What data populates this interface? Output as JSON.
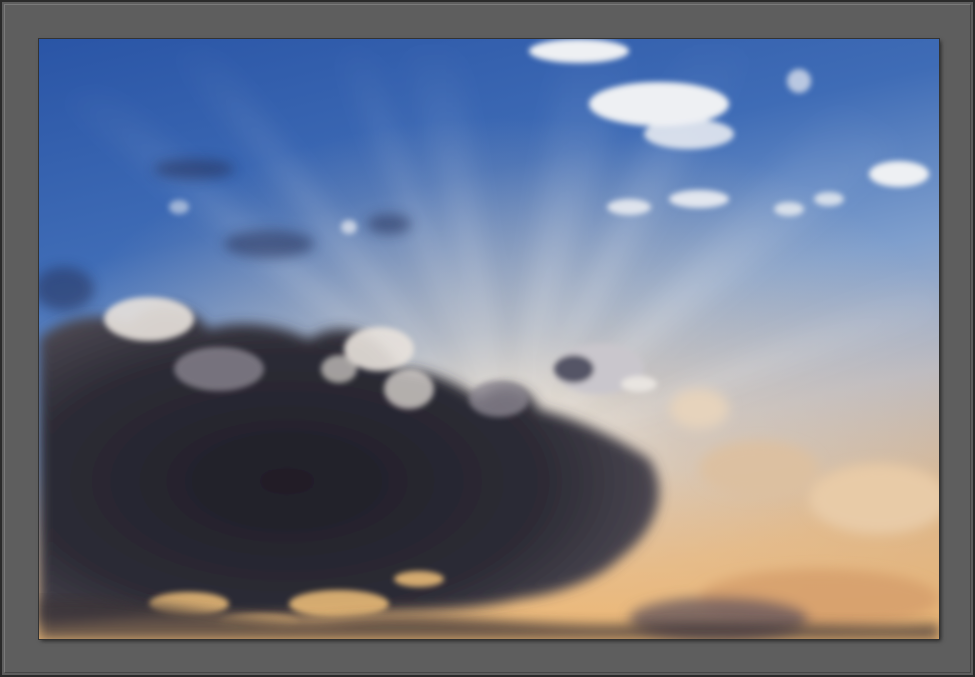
{
  "photo": {
    "subject": "sky-with-clouds-and-sun-rays",
    "colors": {
      "frame": "#5e5e5e",
      "sky_top": "#2f5aa8",
      "sky_mid": "#6e95cc",
      "horizon_glow": "#e8c9a0",
      "cloud_dark": "#2b2a33",
      "cloud_light": "#f2efe9"
    }
  }
}
